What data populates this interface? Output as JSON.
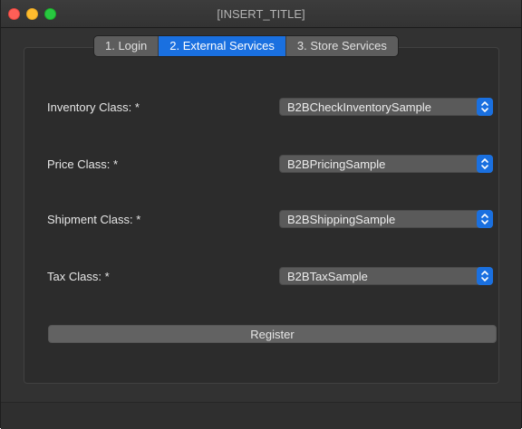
{
  "window": {
    "title": "[INSERT_TITLE]"
  },
  "tabs": [
    {
      "label": "1. Login",
      "active": false
    },
    {
      "label": "2. External Services",
      "active": true
    },
    {
      "label": "3. Store Services",
      "active": false
    }
  ],
  "form": {
    "inventory": {
      "label": "Inventory Class: *",
      "value": "B2BCheckInventorySample"
    },
    "price": {
      "label": "Price Class: *",
      "value": "B2BPricingSample"
    },
    "shipment": {
      "label": "Shipment Class: *",
      "value": "B2BShippingSample"
    },
    "tax": {
      "label": "Tax Class: *",
      "value": "B2BTaxSample"
    }
  },
  "actions": {
    "register_label": "Register"
  },
  "colors": {
    "accent": "#1a70e0",
    "background": "#323232",
    "close": "#ff5f57",
    "minimize": "#febc2e",
    "maximize": "#28c840"
  },
  "icons": {
    "stepper": "chevron-up-down-icon"
  }
}
